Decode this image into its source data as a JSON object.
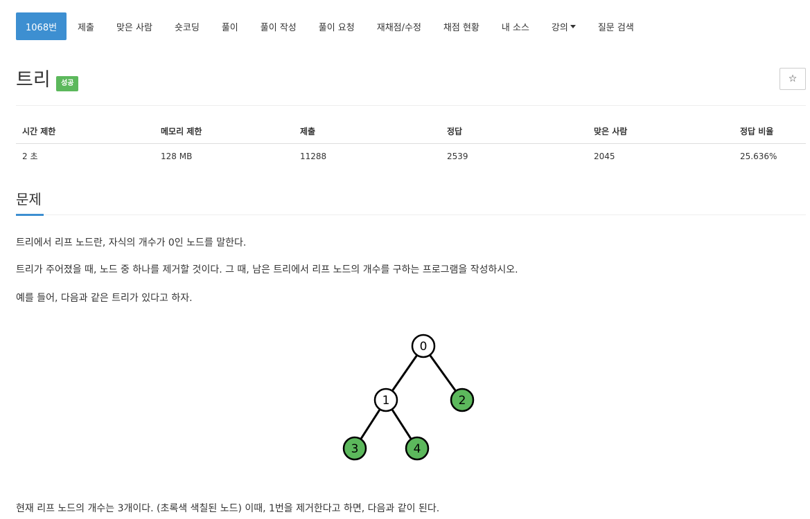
{
  "nav": {
    "items": [
      {
        "label": "1068번",
        "active": true
      },
      {
        "label": "제출"
      },
      {
        "label": "맞은 사람"
      },
      {
        "label": "숏코딩"
      },
      {
        "label": "풀이"
      },
      {
        "label": "풀이 작성"
      },
      {
        "label": "풀이 요청"
      },
      {
        "label": "재채점/수정"
      },
      {
        "label": "채점 현황"
      },
      {
        "label": "내 소스"
      },
      {
        "label": "강의",
        "dropdown": true
      },
      {
        "label": "질문 검색"
      }
    ]
  },
  "problem": {
    "title": "트리",
    "status_badge": "성공",
    "star_icon": "☆"
  },
  "info": {
    "headers": [
      "시간 제한",
      "메모리 제한",
      "제출",
      "정답",
      "맞은 사람",
      "정답 비율"
    ],
    "values": [
      "2 초",
      "128 MB",
      "11288",
      "2539",
      "2045",
      "25.636%"
    ]
  },
  "section": {
    "title": "문제"
  },
  "description": {
    "p1": "트리에서 리프 노드란, 자식의 개수가 0인 노드를 말한다.",
    "p2": "트리가 주어졌을 때, 노드 중 하나를 제거할 것이다. 그 때, 남은 트리에서 리프 노드의 개수를 구하는 프로그램을 작성하시오.",
    "p3": "예를 들어, 다음과 같은 트리가 있다고 하자.",
    "p4": "현재 리프 노드의 개수는 3개이다. (초록색 색칠된 노드) 이때, 1번을 제거한다고 하면, 다음과 같이 된다."
  },
  "tree_figure": {
    "nodes": [
      {
        "label": "0",
        "leaf": false
      },
      {
        "label": "1",
        "leaf": false
      },
      {
        "label": "2",
        "leaf": true
      },
      {
        "label": "3",
        "leaf": true
      },
      {
        "label": "4",
        "leaf": true
      }
    ],
    "leaf_color": "#5cb85c"
  },
  "colors": {
    "accent": "#3d8fd1",
    "success": "#5cb85c"
  }
}
